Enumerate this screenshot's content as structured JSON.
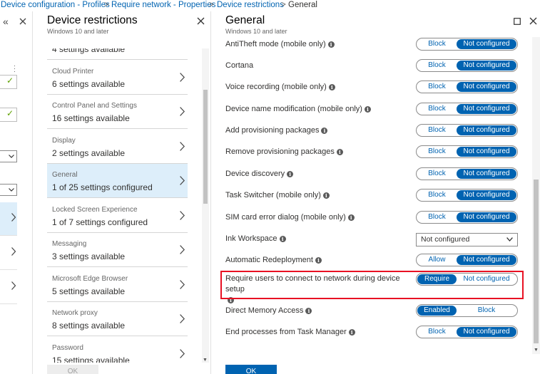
{
  "breadcrumb": {
    "items": [
      "Device configuration - Profiles",
      "Require network - Properties",
      "Device restrictions",
      "General"
    ],
    "separator": ">"
  },
  "restrictions_blade": {
    "title": "Device restrictions",
    "subtitle": "Windows 10 and later",
    "items": [
      {
        "name": "",
        "detail": "4 settings available"
      },
      {
        "name": "Cloud Printer",
        "detail": "6 settings available"
      },
      {
        "name": "Control Panel and Settings",
        "detail": "16 settings available"
      },
      {
        "name": "Display",
        "detail": "2 settings available"
      },
      {
        "name": "General",
        "detail": "1 of 25 settings configured"
      },
      {
        "name": "Locked Screen Experience",
        "detail": "1 of 7 settings configured"
      },
      {
        "name": "Messaging",
        "detail": "3 settings available"
      },
      {
        "name": "Microsoft Edge Browser",
        "detail": "5 settings available"
      },
      {
        "name": "Network proxy",
        "detail": "8 settings available"
      },
      {
        "name": "Password",
        "detail": "15 settings available"
      }
    ],
    "ok_label": "OK"
  },
  "general_blade": {
    "title": "General",
    "subtitle": "Windows 10 and later",
    "settings": [
      {
        "label": "AntiTheft mode (mobile only)",
        "info": true,
        "left": "Block",
        "right": "Not configured",
        "selected": "right"
      },
      {
        "label": "Cortana",
        "info": false,
        "left": "Block",
        "right": "Not configured",
        "selected": "right"
      },
      {
        "label": "Voice recording (mobile only)",
        "info": true,
        "left": "Block",
        "right": "Not configured",
        "selected": "right"
      },
      {
        "label": "Device name modification (mobile only)",
        "info": true,
        "left": "Block",
        "right": "Not configured",
        "selected": "right"
      },
      {
        "label": "Add provisioning packages",
        "info": true,
        "left": "Block",
        "right": "Not configured",
        "selected": "right"
      },
      {
        "label": "Remove provisioning packages",
        "info": true,
        "left": "Block",
        "right": "Not configured",
        "selected": "right"
      },
      {
        "label": "Device discovery",
        "info": true,
        "left": "Block",
        "right": "Not configured",
        "selected": "right"
      },
      {
        "label": "Task Switcher (mobile only)",
        "info": true,
        "left": "Block",
        "right": "Not configured",
        "selected": "right"
      },
      {
        "label": "SIM card error dialog (mobile only)",
        "info": true,
        "left": "Block",
        "right": "Not configured",
        "selected": "right"
      },
      {
        "label": "Ink Workspace",
        "info": true,
        "dropdown": "Not configured"
      },
      {
        "label": "Automatic Redeployment",
        "info": true,
        "left": "Allow",
        "right": "Not configured",
        "selected": "right"
      },
      {
        "label": "Require users to connect to network during device setup",
        "info": true,
        "left": "Require",
        "right": "Not configured",
        "selected": "left"
      },
      {
        "label": "Direct Memory Access",
        "info": true,
        "left": "Enabled",
        "right": "Block",
        "selected": "left"
      },
      {
        "label": "End processes from Task Manager",
        "info": true,
        "left": "Block",
        "right": "Not configured",
        "selected": "right"
      }
    ],
    "ok_label": "OK"
  },
  "colors": {
    "accent": "#0063b1",
    "highlight_border": "#e81123",
    "active_row": "#ddeefa"
  }
}
